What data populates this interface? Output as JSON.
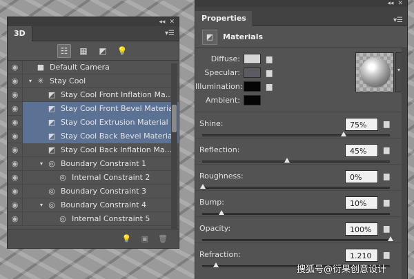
{
  "panel3d": {
    "tab_label": "3D",
    "collapse_glyph": "◂◂",
    "close_glyph": "✕",
    "menu_glyph": "▾☰",
    "filter_tools": [
      {
        "icon": "scene-filter-icon",
        "glyph": "☷",
        "active": true
      },
      {
        "icon": "mesh-filter-icon",
        "glyph": "▦",
        "active": false
      },
      {
        "icon": "material-filter-icon",
        "glyph": "◩",
        "active": false
      },
      {
        "icon": "light-filter-icon",
        "glyph": "💡",
        "active": false
      }
    ],
    "rows": [
      {
        "label": "Default Camera",
        "indent": 0,
        "twisty": "",
        "icon": "camera-icon",
        "glyph": "■",
        "eye": false,
        "selected": false
      },
      {
        "label": "Stay  Cool",
        "indent": 0,
        "twisty": "▾",
        "icon": "mesh-icon",
        "glyph": "✳",
        "eye": true,
        "selected": false
      },
      {
        "label": "Stay  Cool Front Inflation Ma...",
        "indent": 1,
        "twisty": "",
        "icon": "material-icon",
        "glyph": "◩",
        "eye": true,
        "selected": false
      },
      {
        "label": "Stay  Cool Front Bevel Material",
        "indent": 1,
        "twisty": "",
        "icon": "material-icon",
        "glyph": "◩",
        "eye": true,
        "selected": true
      },
      {
        "label": "Stay  Cool Extrusion Material",
        "indent": 1,
        "twisty": "",
        "icon": "material-icon",
        "glyph": "◩",
        "eye": true,
        "selected": true
      },
      {
        "label": "Stay  Cool Back Bevel Material",
        "indent": 1,
        "twisty": "",
        "icon": "material-icon",
        "glyph": "◩",
        "eye": true,
        "selected": true
      },
      {
        "label": "Stay  Cool Back Inflation Ma...",
        "indent": 1,
        "twisty": "",
        "icon": "material-icon",
        "glyph": "◩",
        "eye": true,
        "selected": false
      },
      {
        "label": "Boundary Constraint 1",
        "indent": 1,
        "twisty": "▾",
        "icon": "constraint-icon",
        "glyph": "◎",
        "eye": false,
        "selected": false
      },
      {
        "label": "Internal Constraint 2",
        "indent": 2,
        "twisty": "",
        "icon": "constraint-icon",
        "glyph": "◎",
        "eye": false,
        "selected": false
      },
      {
        "label": "Boundary Constraint 3",
        "indent": 1,
        "twisty": "",
        "icon": "constraint-icon",
        "glyph": "◎",
        "eye": false,
        "selected": false
      },
      {
        "label": "Boundary Constraint 4",
        "indent": 1,
        "twisty": "▾",
        "icon": "constraint-icon",
        "glyph": "◎",
        "eye": false,
        "selected": false
      },
      {
        "label": "Internal Constraint 5",
        "indent": 2,
        "twisty": "",
        "icon": "constraint-icon",
        "glyph": "◎",
        "eye": false,
        "selected": false
      }
    ],
    "bottom_tools": [
      {
        "icon": "add-light-icon",
        "glyph": "💡"
      },
      {
        "icon": "render-icon",
        "glyph": "▣"
      },
      {
        "icon": "delete-icon",
        "glyph": "🗑"
      }
    ]
  },
  "properties": {
    "tab_label": "Properties",
    "collapse_glyph": "◂◂",
    "close_glyph": "✕",
    "menu_glyph": "▾☰",
    "header_title": "Materials",
    "colors": [
      {
        "label": "Diffuse:",
        "color": "#d6d6d6",
        "folder": true
      },
      {
        "label": "Specular:",
        "color": "#5c5b63",
        "folder": true
      },
      {
        "label": "Illumination:",
        "color": "#050505",
        "folder": true
      },
      {
        "label": "Ambient:",
        "color": "#050505",
        "folder": false
      }
    ],
    "sliders": [
      {
        "label": "Shine:",
        "value": "75%",
        "level": 0.75
      },
      {
        "label": "Reflection:",
        "value": "45%",
        "level": 0.45
      },
      {
        "label": "Roughness:",
        "value": "0%",
        "level": 0.0
      },
      {
        "label": "Bump:",
        "value": "10%",
        "level": 0.1
      },
      {
        "label": "Opacity:",
        "value": "100%",
        "level": 1.0
      },
      {
        "label": "Refraction:",
        "value": "1.210",
        "level": 0.07
      }
    ]
  },
  "watermark": "搜狐号@衍果创意设计"
}
